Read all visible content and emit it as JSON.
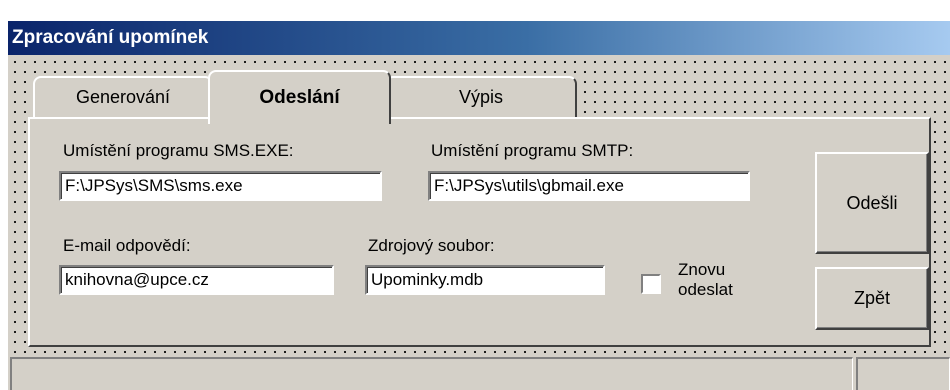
{
  "window": {
    "title": "Zpracování upomínek"
  },
  "tabs": [
    {
      "label": "Generování",
      "active": false
    },
    {
      "label": "Odeslání",
      "active": true
    },
    {
      "label": "Výpis",
      "active": false
    }
  ],
  "form": {
    "sms_label": "Umístění programu  SMS.EXE:",
    "sms_value": "F:\\JPSys\\SMS\\sms.exe",
    "smtp_label": "Umístění programu  SMTP:",
    "smtp_value": "F:\\JPSys\\utils\\gbmail.exe",
    "email_label": "E-mail odpovědí:",
    "email_value": "knihovna@upce.cz",
    "source_label": "Zdrojový soubor:",
    "source_value": "Upominky.mdb",
    "resend_label_line1": "Znovu",
    "resend_label_line2": "odeslat",
    "resend_checked": false
  },
  "buttons": {
    "send_label": "Odešli",
    "back_label": "Zpět"
  },
  "colors": {
    "titlebar_start": "#0a246a",
    "titlebar_end": "#a6caf0",
    "face": "#d4d0c8"
  }
}
